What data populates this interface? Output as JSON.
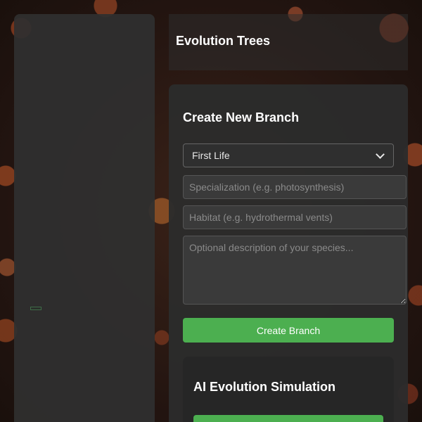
{
  "header": {
    "title": "Evolution Trees"
  },
  "create_branch": {
    "title": "Create New Branch",
    "parent_select": {
      "selected": "First Life"
    },
    "specialization": {
      "placeholder": "Specialization (e.g. photosynthesis)",
      "value": ""
    },
    "habitat": {
      "placeholder": "Habitat (e.g. hydrothermal vents)",
      "value": ""
    },
    "description": {
      "placeholder": "Optional description of your species...",
      "value": ""
    },
    "submit_label": "Create Branch"
  },
  "ai_simulation": {
    "title": "AI Evolution Simulation"
  },
  "colors": {
    "accent": "#4caf50",
    "panel": "#2f2f2f",
    "input_bg": "#3a3a3a",
    "text": "#ffffff"
  },
  "icons": {
    "select_chevron": "chevron-down-icon",
    "resize_grip": "resize-grip-icon"
  }
}
